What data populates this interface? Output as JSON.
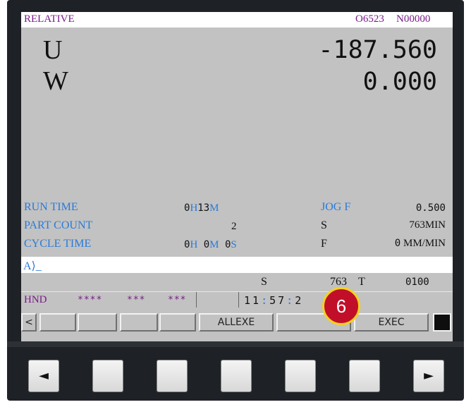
{
  "header": {
    "mode": "RELATIVE",
    "program": "O6523",
    "sequence": "N00000"
  },
  "axes": [
    {
      "name": "U",
      "value": "-187.560"
    },
    {
      "name": "W",
      "value": "0.000"
    }
  ],
  "stats": {
    "run_time": {
      "label": "RUN TIME",
      "h_val": "0",
      "h_unit": "H",
      "m_val": "13",
      "m_unit": "M"
    },
    "part_count": {
      "label": "PART COUNT",
      "value": "2"
    },
    "cycle_time": {
      "label": "CYCLE TIME",
      "h_val": "0",
      "h_unit": "H",
      "m_val": "0",
      "m_unit": "M",
      "s_val": "0",
      "s_unit": "S"
    },
    "jog_f": {
      "label": "JOG F",
      "value": "0.500"
    },
    "spindle": {
      "label": "S",
      "value": "763",
      "unit": "MIN"
    },
    "feed": {
      "label": "F",
      "value": "0",
      "unit": "MM/MIN"
    }
  },
  "input_prompt": "A⟩_",
  "spindle_bar": {
    "s_label": "S",
    "s_value": "763",
    "t_label": "T",
    "t_value": "0100"
  },
  "status": {
    "mode": "HND",
    "field1": "****",
    "field2": "***",
    "field3": "***",
    "clock_h": "11",
    "clock_m": "57",
    "clock_s": "2",
    "clock_sep": ":"
  },
  "softkeys": {
    "left_arrow": "<",
    "allexe": "ALLEXE",
    "exec": "EXEC"
  },
  "callout": "6",
  "hardware_keys": {
    "left": "◄",
    "right": "►"
  },
  "colors": {
    "accent_blue": "#2a7ad8",
    "purple": "#7a1a8a",
    "screen_bg": "#c2c2c2",
    "callout_red": "#c10f2a",
    "callout_ring": "#f4d21e"
  }
}
